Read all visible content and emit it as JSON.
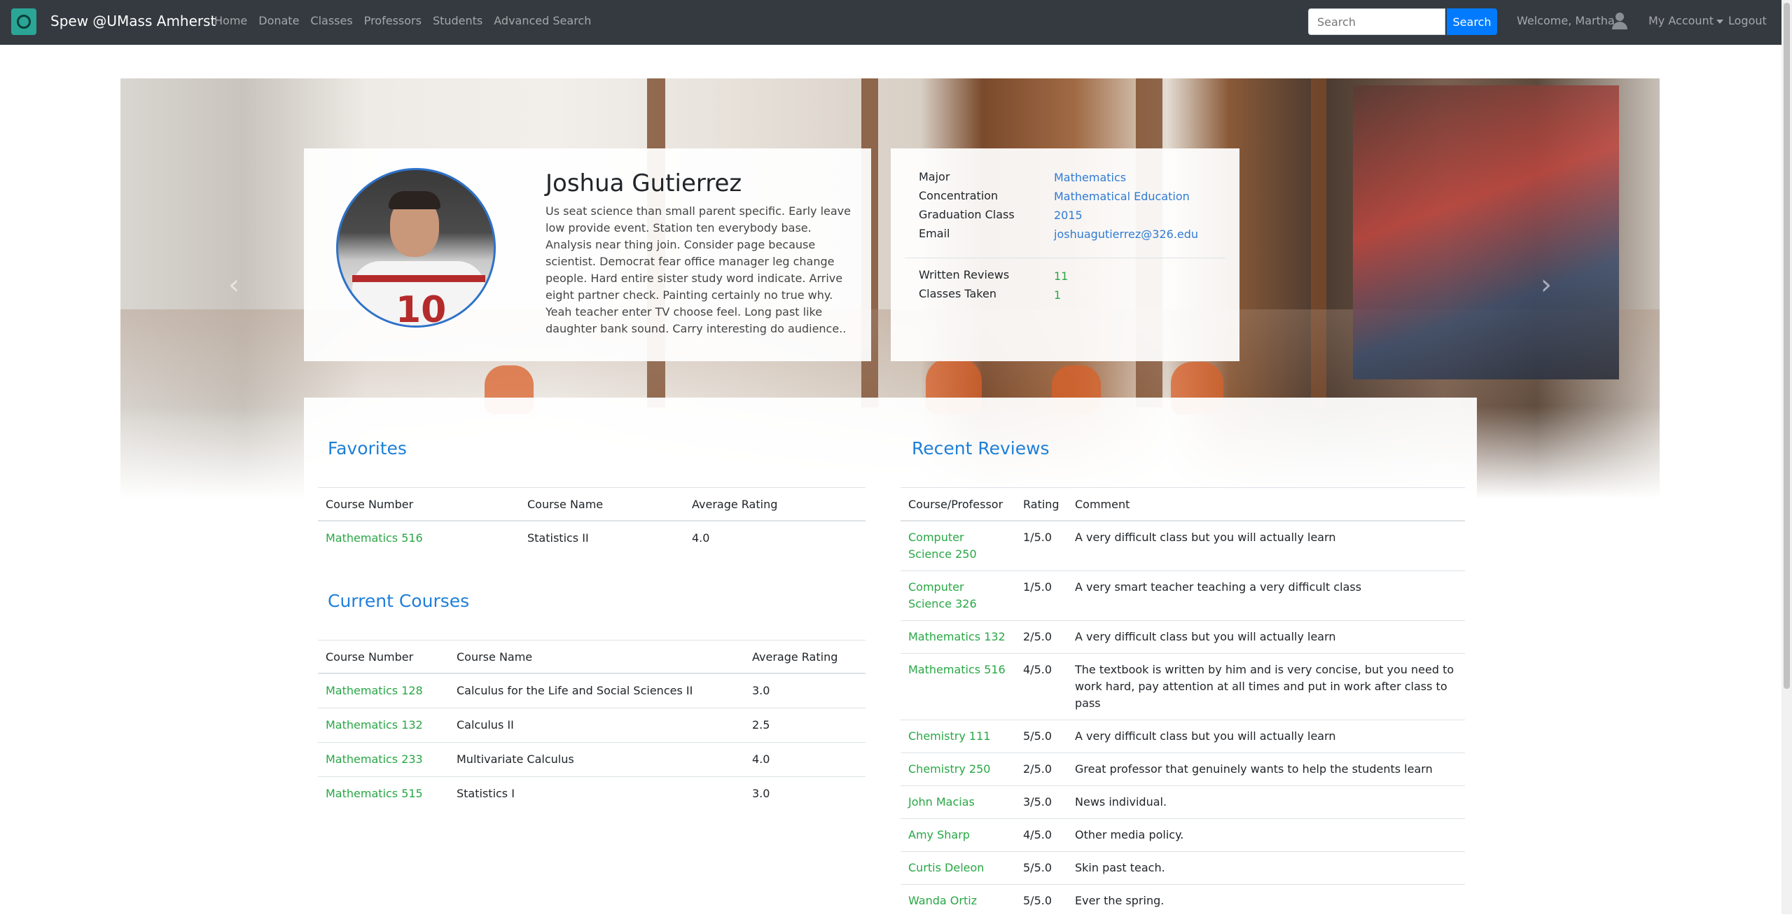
{
  "nav": {
    "brand": "Spew @UMass Amherst",
    "links": [
      "Home",
      "Donate",
      "Classes",
      "Professors",
      "Students",
      "Advanced Search"
    ],
    "search_placeholder": "Search",
    "search_button": "Search",
    "welcome": "Welcome, Martha",
    "account": "My Account",
    "logout": "Logout"
  },
  "profile": {
    "name": "Joshua Gutierrez",
    "bio": "Us seat science than small parent specific. Early leave low provide event. Station ten everybody base. Analysis near thing join. Consider page because scientist. Democrat fear office manager leg change people. Hard entire sister study word indicate. Arrive eight partner check. Painting certainly no true why. Yeah teacher enter TV choose feel. Long past like daughter bank sound. Carry interesting do audience..",
    "major_label": "Major",
    "major": "Mathematics",
    "concentration_label": "Concentration",
    "concentration": "Mathematical Education",
    "graduation_label": "Graduation Class",
    "graduation": "2015",
    "email_label": "Email",
    "email": "joshuagutierrez@326.edu",
    "reviews_label": "Written Reviews",
    "reviews_count": "11",
    "classes_label": "Classes Taken",
    "classes_count": "1"
  },
  "favorites": {
    "title": "Favorites",
    "headers": [
      "Course Number",
      "Course Name",
      "Average Rating"
    ],
    "rows": [
      {
        "number": "Mathematics 516",
        "name": "Statistics II",
        "rating": "4.0"
      }
    ]
  },
  "current_courses": {
    "title": "Current Courses",
    "headers": [
      "Course Number",
      "Course Name",
      "Average Rating"
    ],
    "rows": [
      {
        "number": "Mathematics 128",
        "name": "Calculus for the Life and Social Sciences II",
        "rating": "3.0"
      },
      {
        "number": "Mathematics 132",
        "name": "Calculus II",
        "rating": "2.5"
      },
      {
        "number": "Mathematics 233",
        "name": "Multivariate Calculus",
        "rating": "4.0"
      },
      {
        "number": "Mathematics 515",
        "name": "Statistics I",
        "rating": "3.0"
      }
    ]
  },
  "recent_reviews": {
    "title": "Recent Reviews",
    "headers": [
      "Course/Professor",
      "Rating",
      "Comment"
    ],
    "rows": [
      {
        "subject": "Computer Science 250",
        "rating": "1/5.0",
        "comment": "A very difficult class but you will actually learn"
      },
      {
        "subject": "Computer Science 326",
        "rating": "1/5.0",
        "comment": "A very smart teacher teaching a very difficult class"
      },
      {
        "subject": "Mathematics 132",
        "rating": "2/5.0",
        "comment": "A very difficult class but you will actually learn"
      },
      {
        "subject": "Mathematics 516",
        "rating": "4/5.0",
        "comment": "The textbook is written by him and is very concise, but you need to work hard, pay attention at all times and put in work after class to pass"
      },
      {
        "subject": "Chemistry 111",
        "rating": "5/5.0",
        "comment": "A very difficult class but you will actually learn"
      },
      {
        "subject": "Chemistry 250",
        "rating": "2/5.0",
        "comment": "Great professor that genuinely wants to help the students learn"
      },
      {
        "subject": "John Macias",
        "rating": "3/5.0",
        "comment": "News individual."
      },
      {
        "subject": "Amy Sharp",
        "rating": "4/5.0",
        "comment": "Other media policy."
      },
      {
        "subject": "Curtis Deleon",
        "rating": "5/5.0",
        "comment": "Skin past teach."
      },
      {
        "subject": "Wanda Ortiz",
        "rating": "5/5.0",
        "comment": "Ever the spring."
      }
    ]
  },
  "colors": {
    "navbar": "#343a40",
    "link_green": "#28a745",
    "heading_blue": "#1e7fd8",
    "primary": "#007bff"
  }
}
